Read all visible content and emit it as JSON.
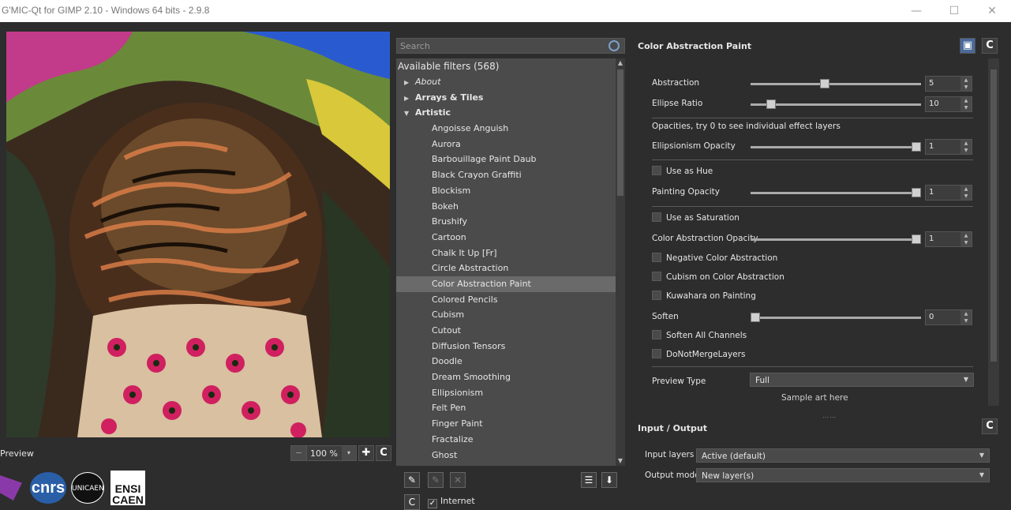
{
  "window": {
    "title": "G'MIC-Qt for GIMP 2.10 - Windows 64 bits - 2.9.8",
    "minimize": "—",
    "maximize": "☐",
    "close": "✕"
  },
  "preview": {
    "label": "Preview",
    "zoom": "100 %",
    "zoom_minus": "−",
    "zoom_dropdown": "▾",
    "zoom_in_icon": "✚",
    "refresh_icon": "C",
    "logos": {
      "cnrs": "cnrs",
      "unicaen": "UNICAEN",
      "ensi_top": "ENSI",
      "ensi_bottom": "CAEN"
    }
  },
  "filters": {
    "search_placeholder": "Search",
    "header": "Available filters (568)",
    "folders": {
      "about": "About",
      "arrays": "Arrays & Tiles",
      "artistic": "Artistic"
    },
    "artistic_items": [
      "Angoisse Anguish",
      "Aurora",
      "Barbouillage Paint Daub",
      "Black Crayon Graffiti",
      "Blockism",
      "Bokeh",
      "Brushify",
      "Cartoon",
      "Chalk It Up [Fr]",
      "Circle Abstraction",
      "Color Abstraction Paint",
      "Colored Pencils",
      "Cubism",
      "Cutout",
      "Diffusion Tensors",
      "Doodle",
      "Dream Smoothing",
      "Ellipsionism",
      "Felt Pen",
      "Finger Paint",
      "Fractalize",
      "Ghost"
    ],
    "selected": "Color Abstraction Paint",
    "internet_label": "Internet"
  },
  "params": {
    "title": "Color Abstraction Paint",
    "abstraction": {
      "label": "Abstraction",
      "value": "5",
      "fraction": 0.43
    },
    "ellipse_ratio": {
      "label": "Ellipse Ratio",
      "value": "10",
      "fraction": 0.1
    },
    "opacities_note": "Opacities, try 0 to see individual effect layers",
    "ellipsionism_opacity": {
      "label": "Ellipsionism Opacity",
      "value": "1",
      "fraction": 1.0
    },
    "use_as_hue": "Use as Hue",
    "painting_opacity": {
      "label": "Painting Opacity",
      "value": "1",
      "fraction": 1.0
    },
    "use_as_saturation": "Use as Saturation",
    "color_abstraction_opacity": {
      "label": "Color Abstraction Opacity",
      "value": "1",
      "fraction": 1.0
    },
    "negative_color_abstraction": "Negative Color Abstraction",
    "cubism_on_color_abstraction": "Cubism on Color Abstraction",
    "kuwahara_on_painting": "Kuwahara on Painting",
    "soften": {
      "label": "Soften",
      "value": "0",
      "fraction": 0.0
    },
    "soften_all_channels": "Soften All Channels",
    "do_not_merge_layers": "DoNotMergeLayers",
    "preview_type": {
      "label": "Preview Type",
      "value": "Full"
    },
    "sample_art": "Sample art here"
  },
  "io": {
    "title": "Input / Output",
    "input_layers": {
      "label": "Input layers",
      "value": "Active (default)"
    },
    "output_mode": {
      "label": "Output mode",
      "value": "New layer(s)"
    }
  },
  "colors": {
    "background": "#2d2d2d",
    "list_bg": "#4b4b4b",
    "selected_row": "#6a6a6a"
  }
}
